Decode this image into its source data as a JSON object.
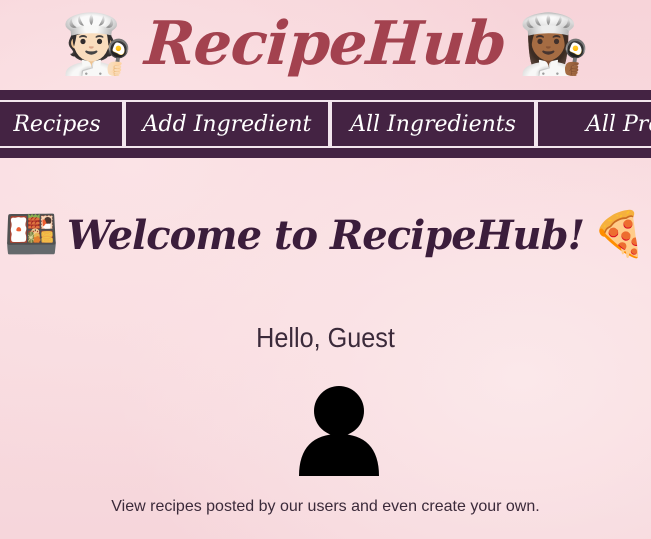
{
  "header": {
    "brand": "RecipeHub",
    "left_emoji": "🧑🏻‍🍳",
    "right_emoji": "👩🏾‍🍳"
  },
  "nav": {
    "items": [
      {
        "label": "Recipes"
      },
      {
        "label": "Add Ingredient"
      },
      {
        "label": "All Ingredients"
      },
      {
        "label": "All Pro"
      }
    ]
  },
  "welcome": {
    "left_emoji": "🍱",
    "title": "Welcome to RecipeHub!",
    "right_emoji": "🍕"
  },
  "greeting": "Hello, Guest",
  "avatar_icon": "user-silhouette-icon",
  "tagline": "View recipes posted by our users and even create your own.",
  "colors": {
    "brand": "#a3424f",
    "nav_bg": "#442343",
    "heading": "#3b1d3b",
    "background": "#f8d9dd"
  }
}
